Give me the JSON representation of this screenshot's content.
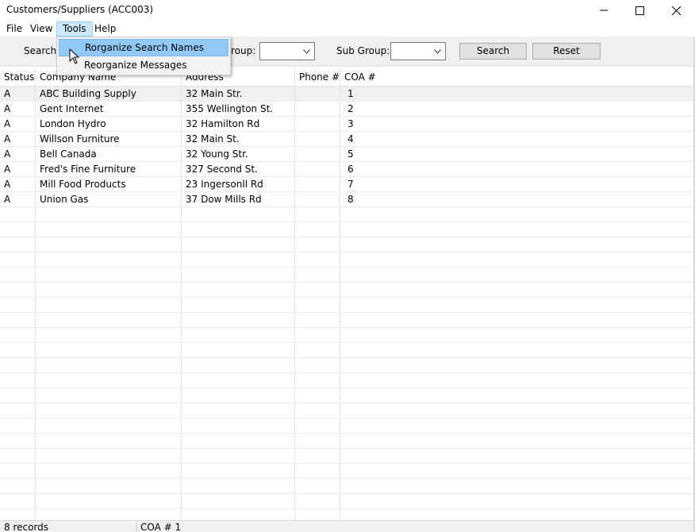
{
  "window": {
    "title": "Customers/Suppliers (ACC003)",
    "controls": [
      "minimize-icon",
      "maximize-icon",
      "close-icon"
    ]
  },
  "menu": {
    "items": [
      {
        "label": "File"
      },
      {
        "label": "View"
      },
      {
        "label": "Tools",
        "active": true
      },
      {
        "label": "Help"
      }
    ]
  },
  "toolbar": {
    "search_label": "Search:",
    "group_label_partial": "roup:",
    "group_value": "",
    "subgroup_label": "Sub Group:",
    "subgroup_value": "",
    "search_button": "Search",
    "reset_button": "Reset"
  },
  "tools_menu": {
    "items": [
      {
        "label": "Rorganize Search Names",
        "highlighted": true
      },
      {
        "label": "Reorganize Messages",
        "highlighted": false
      }
    ]
  },
  "grid": {
    "columns": [
      "Status",
      "Company Name",
      "Address",
      "Phone #",
      "COA #"
    ],
    "rows": [
      {
        "status": "A",
        "company": "ABC Building Supply",
        "address": "32 Main Str.",
        "phone": "",
        "coa": "1"
      },
      {
        "status": "A",
        "company": "Gent Internet",
        "address": "355 Wellington St.",
        "phone": "",
        "coa": "2"
      },
      {
        "status": "A",
        "company": "London Hydro",
        "address": "32 Hamilton Rd",
        "phone": "",
        "coa": "3"
      },
      {
        "status": "A",
        "company": "Willson Furniture",
        "address": "32 Main St.",
        "phone": "",
        "coa": "4"
      },
      {
        "status": "A",
        "company": "Bell Canada",
        "address": "32 Young Str.",
        "phone": "",
        "coa": "5"
      },
      {
        "status": "A",
        "company": "Fred's Fine Furniture",
        "address": "327 Second St.",
        "phone": "",
        "coa": "6"
      },
      {
        "status": "A",
        "company": "Mill Food Products",
        "address": "23 Ingersonll Rd",
        "phone": "",
        "coa": "7"
      },
      {
        "status": "A",
        "company": "Union Gas",
        "address": "37 Dow Mills Rd",
        "phone": "",
        "coa": "8"
      }
    ]
  },
  "status_bar": {
    "records": "8 records",
    "coa": "COA # 1"
  },
  "colors": {
    "highlight": "#91c9f7",
    "menu_active": "#cce8ff",
    "toolbar_bg": "#f0f0f0"
  }
}
